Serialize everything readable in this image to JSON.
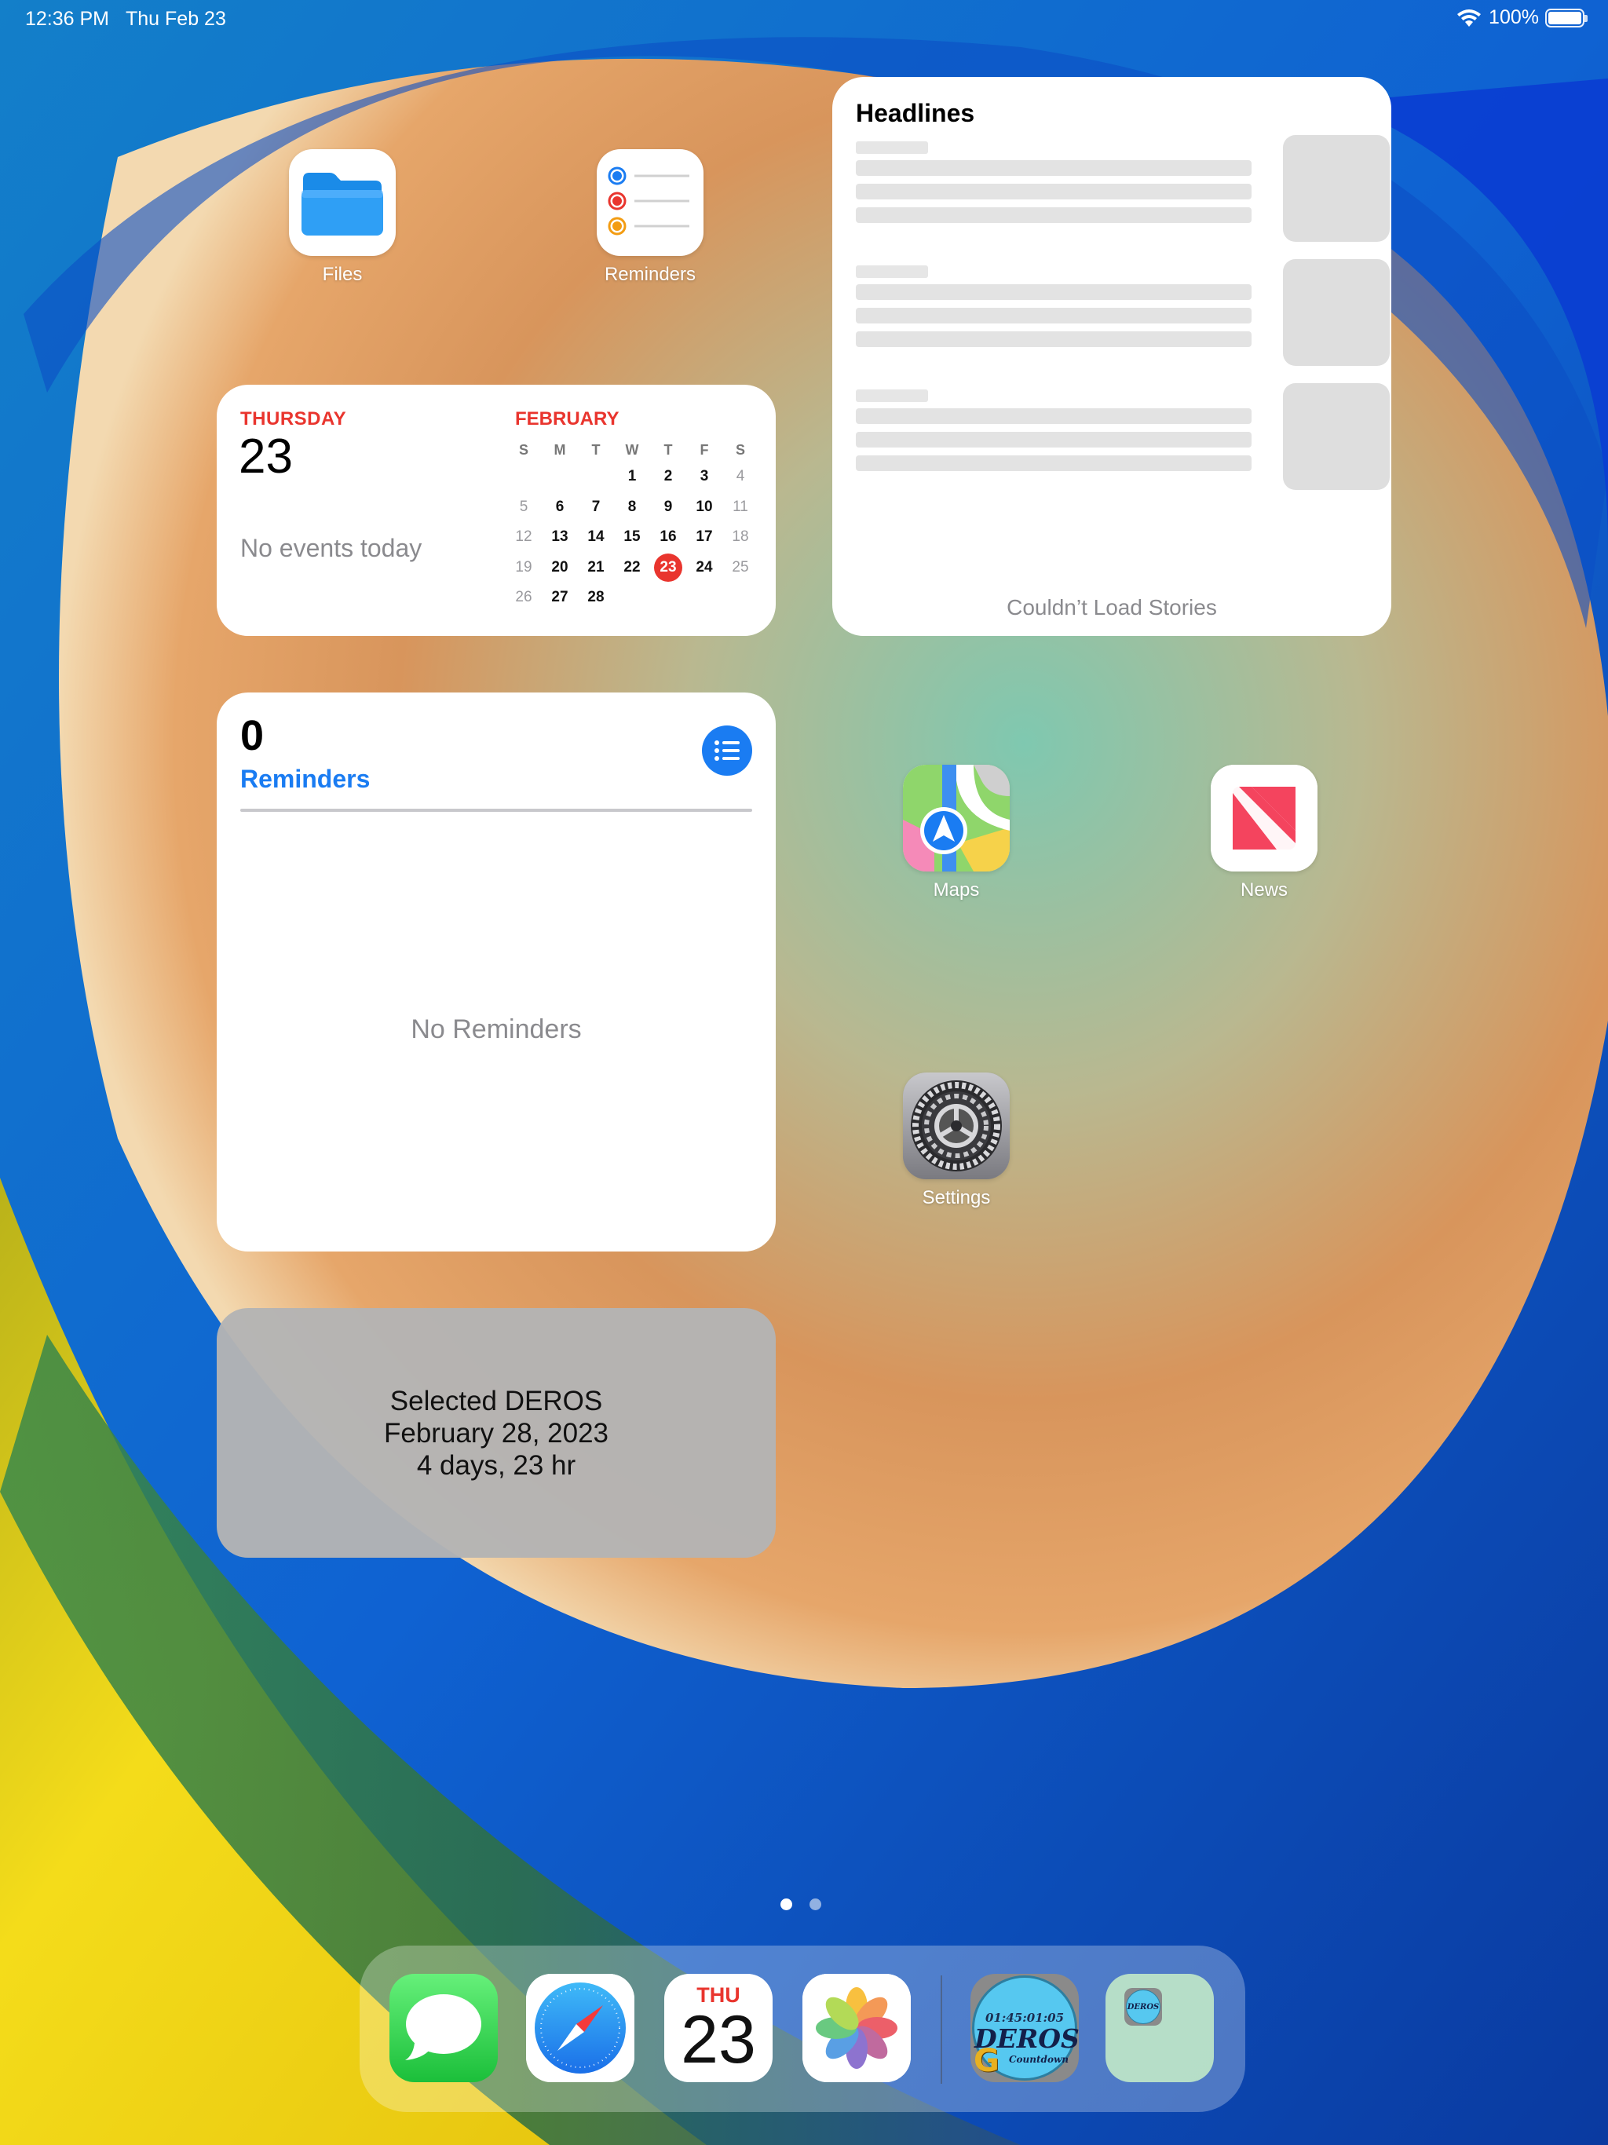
{
  "status_bar": {
    "time": "12:36 PM",
    "date": "Thu Feb 23",
    "battery": "100%"
  },
  "apps": {
    "files": "Files",
    "reminders": "Reminders",
    "maps": "Maps",
    "news": "News",
    "settings": "Settings"
  },
  "calendar_widget": {
    "day_name": "THURSDAY",
    "day_number": "23",
    "no_events": "No events today",
    "month": "FEBRUARY",
    "weekdays": [
      "S",
      "M",
      "T",
      "W",
      "T",
      "F",
      "S"
    ],
    "weeks": [
      [
        "",
        "",
        "",
        "1",
        "2",
        "3",
        "4"
      ],
      [
        "5",
        "6",
        "7",
        "8",
        "9",
        "10",
        "11"
      ],
      [
        "12",
        "13",
        "14",
        "15",
        "16",
        "17",
        "18"
      ],
      [
        "19",
        "20",
        "21",
        "22",
        "23",
        "24",
        "25"
      ],
      [
        "26",
        "27",
        "28",
        "",
        "",
        "",
        ""
      ]
    ],
    "today": "23"
  },
  "news_widget": {
    "title": "Headlines",
    "error": "Couldn’t Load Stories",
    "placeholder_count": 3
  },
  "reminders_widget": {
    "count": "0",
    "title": "Reminders",
    "empty": "No Reminders",
    "button_icon": "list-icon"
  },
  "deros_widget": {
    "line1": "Selected DEROS",
    "line2": "February 28, 2023",
    "line3": "4 days, 23 hr"
  },
  "page_dots": {
    "count": 2,
    "active": 0
  },
  "dock": {
    "apps": [
      "messages-icon",
      "safari-icon",
      "calendar-icon",
      "photos-icon",
      "deros-countdown-icon",
      "folder-icon"
    ],
    "calendar_day": "THU",
    "calendar_date": "23",
    "deros_timer": "01:45:01:05",
    "deros_word": "DEROS",
    "deros_sub": "Countdown",
    "deros_letter": "G",
    "folder_mini": "DEROS"
  },
  "colors": {
    "accent_red": "#e9352e",
    "accent_blue": "#1a7cf2",
    "messages_green": "#32c350"
  }
}
